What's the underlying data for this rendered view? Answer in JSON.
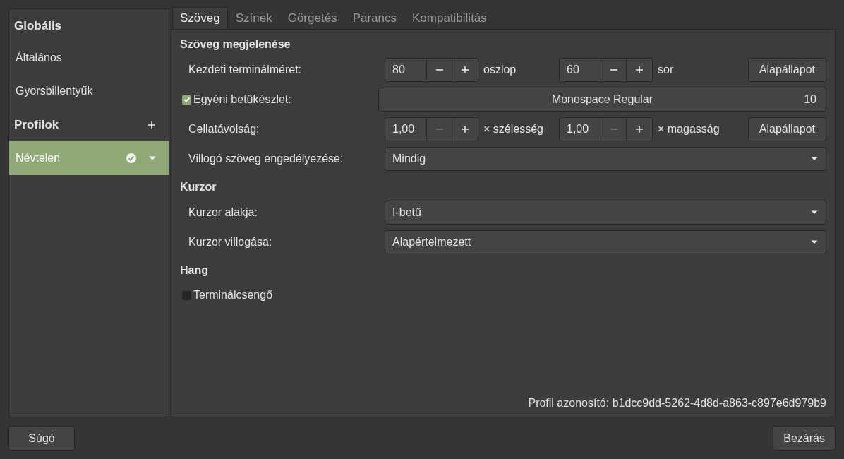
{
  "sidebar": {
    "items": [
      {
        "kind": "heading",
        "label": "Globális",
        "selected": false
      },
      {
        "kind": "item",
        "label": "Általános",
        "selected": false
      },
      {
        "kind": "item",
        "label": "Gyorsbillentyűk",
        "selected": false
      },
      {
        "kind": "heading_add",
        "label": "Profilok",
        "selected": false
      },
      {
        "kind": "profile",
        "label": "Névtelen",
        "selected": true,
        "default": true
      }
    ]
  },
  "tabs": [
    {
      "label": "Szöveg",
      "selected": true
    },
    {
      "label": "Színek",
      "selected": false
    },
    {
      "label": "Görgetés",
      "selected": false
    },
    {
      "label": "Parancs",
      "selected": false
    },
    {
      "label": "Kompatibilitás",
      "selected": false
    }
  ],
  "sections": [
    {
      "title": "Szöveg megjelenése",
      "rows": [
        {
          "kind": "spins",
          "label": "Kezdeti terminálméret:",
          "spins": [
            {
              "value": "80",
              "minus_disabled": false,
              "unit": "oszlop"
            },
            {
              "value": "60",
              "minus_disabled": false,
              "unit": "sor"
            }
          ],
          "button": "Alapállapot"
        },
        {
          "kind": "font",
          "label": "Egyéni betűkészlet:",
          "checked": true,
          "font": "Monospace Regular",
          "size": "10"
        },
        {
          "kind": "spins",
          "label": "Cellatávolság:",
          "spins": [
            {
              "value": "1,00",
              "minus_disabled": true,
              "unit": "× szélesség"
            },
            {
              "value": "1,00",
              "minus_disabled": true,
              "unit": "× magasság"
            }
          ],
          "button": "Alapállapot"
        },
        {
          "kind": "dropdown",
          "label": "Villogó szöveg engedélyezése:",
          "value": "Mindig"
        }
      ]
    },
    {
      "title": "Kurzor",
      "rows": [
        {
          "kind": "dropdown",
          "label": "Kurzor alakja:",
          "value": "I-betű"
        },
        {
          "kind": "dropdown",
          "label": "Kurzor villogása:",
          "value": "Alapértelmezett"
        }
      ]
    },
    {
      "title": "Hang",
      "rows": [
        {
          "kind": "checkbox",
          "label": "Terminálcsengő",
          "checked": false
        }
      ]
    }
  ],
  "profile_id": "Profil azonosító: b1dcc9dd-5262-4d8d-a863-c897e6d979b9",
  "footer": {
    "help": "Súgó",
    "close": "Bezárás"
  }
}
